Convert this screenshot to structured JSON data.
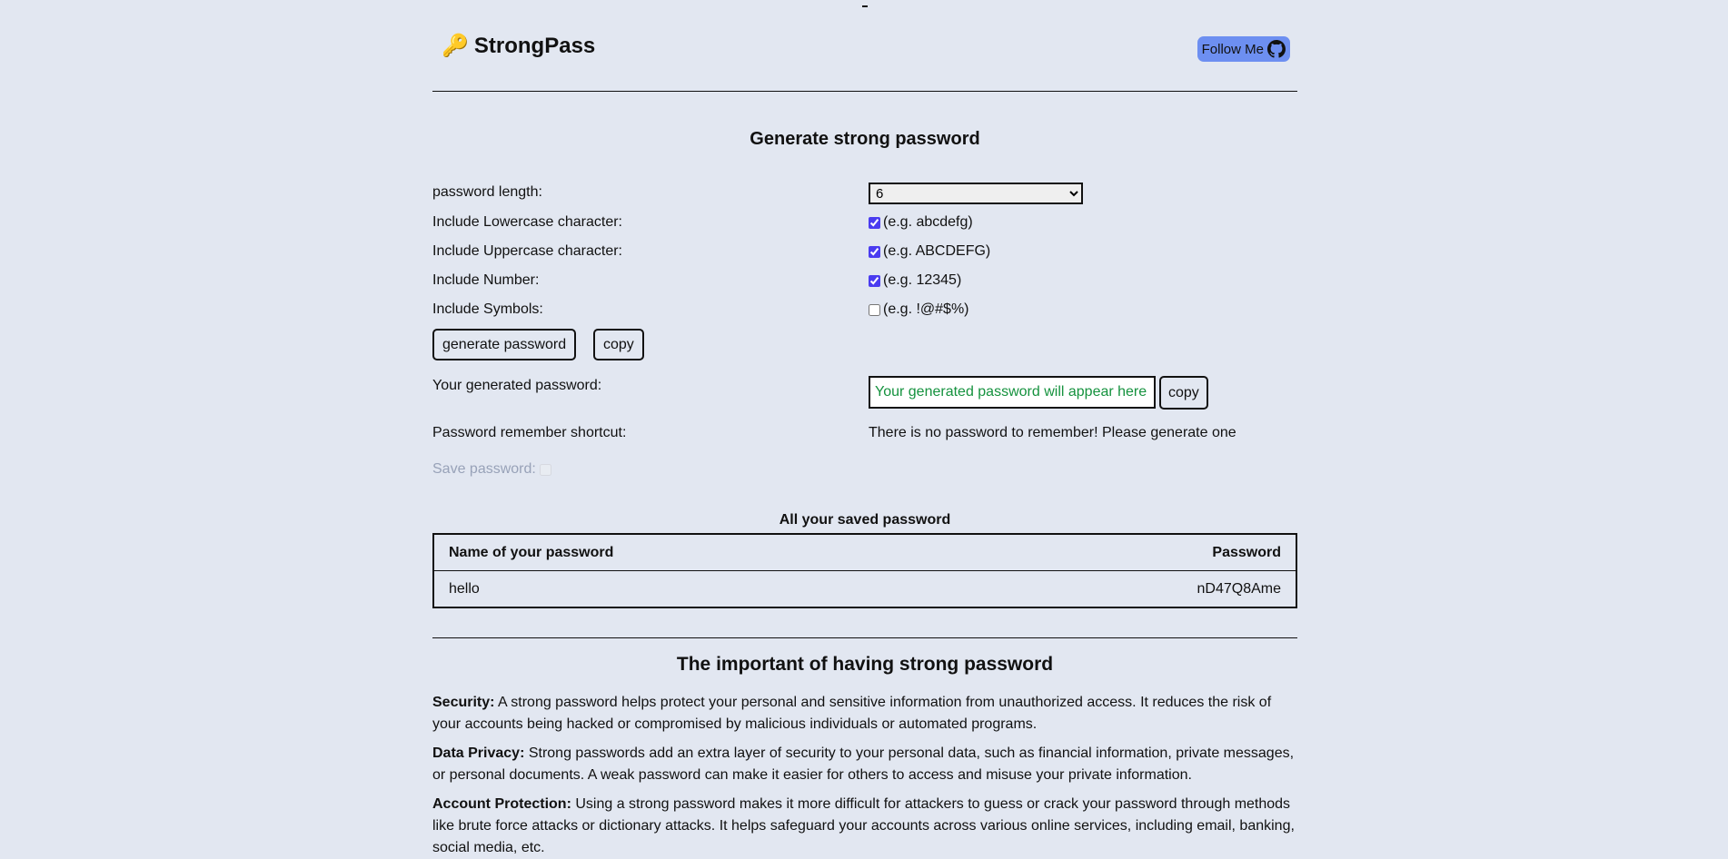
{
  "header": {
    "logo_icon": "key-icon",
    "logo_emoji": "🔑",
    "app_title": "StrongPass",
    "follow_label": "Follow Me",
    "follow_icon": "github-icon",
    "follow_color": "#6d8ff1"
  },
  "generator": {
    "title": "Generate strong password",
    "length_label": "password length:",
    "length_value": "6",
    "options": [
      {
        "label": "Include Lowercase character:",
        "example": "(e.g. abcdefg)",
        "checked": true
      },
      {
        "label": "Include Uppercase character:",
        "example": "(e.g. ABCDEFG)",
        "checked": true
      },
      {
        "label": "Include Number:",
        "example": "(e.g. 12345)",
        "checked": true
      },
      {
        "label": "Include Symbols:",
        "example": "(e.g. !@#$%)",
        "checked": false
      }
    ],
    "generate_button": "generate password",
    "copy_button": "copy",
    "generated_label": "Your generated password:",
    "generated_placeholder": "Your generated password will appear here",
    "generated_copy_button": "copy",
    "remember_label": "Password remember shortcut:",
    "remember_value": "There is no password to remember! Please generate one",
    "save_label": "Save password:",
    "save_checked": false
  },
  "saved": {
    "title": "All your saved password",
    "columns": [
      "Name of your password",
      "Password"
    ],
    "rows": [
      {
        "name": "hello",
        "password": "nD47Q8Ame"
      }
    ]
  },
  "importance": {
    "title": "The important of having strong password",
    "paragraphs": [
      {
        "term": "Security:",
        "text": " A strong password helps protect your personal and sensitive information from unauthorized access. It reduces the risk of your accounts being hacked or compromised by malicious individuals or automated programs."
      },
      {
        "term": "Data Privacy:",
        "text": " Strong passwords add an extra layer of security to your personal data, such as financial information, private messages, or personal documents. A weak password can make it easier for others to access and misuse your private information."
      },
      {
        "term": "Account Protection:",
        "text": " Using a strong password makes it more difficult for attackers to guess or crack your password through methods like brute force attacks or dictionary attacks. It helps safeguard your accounts across various online services, including email, banking, social media, etc."
      }
    ]
  },
  "colors": {
    "background": "#e2e7f1",
    "accent_checkbox": "#4a3cf0",
    "generated_text": "#15923e",
    "disabled_text": "#98a2b8"
  }
}
